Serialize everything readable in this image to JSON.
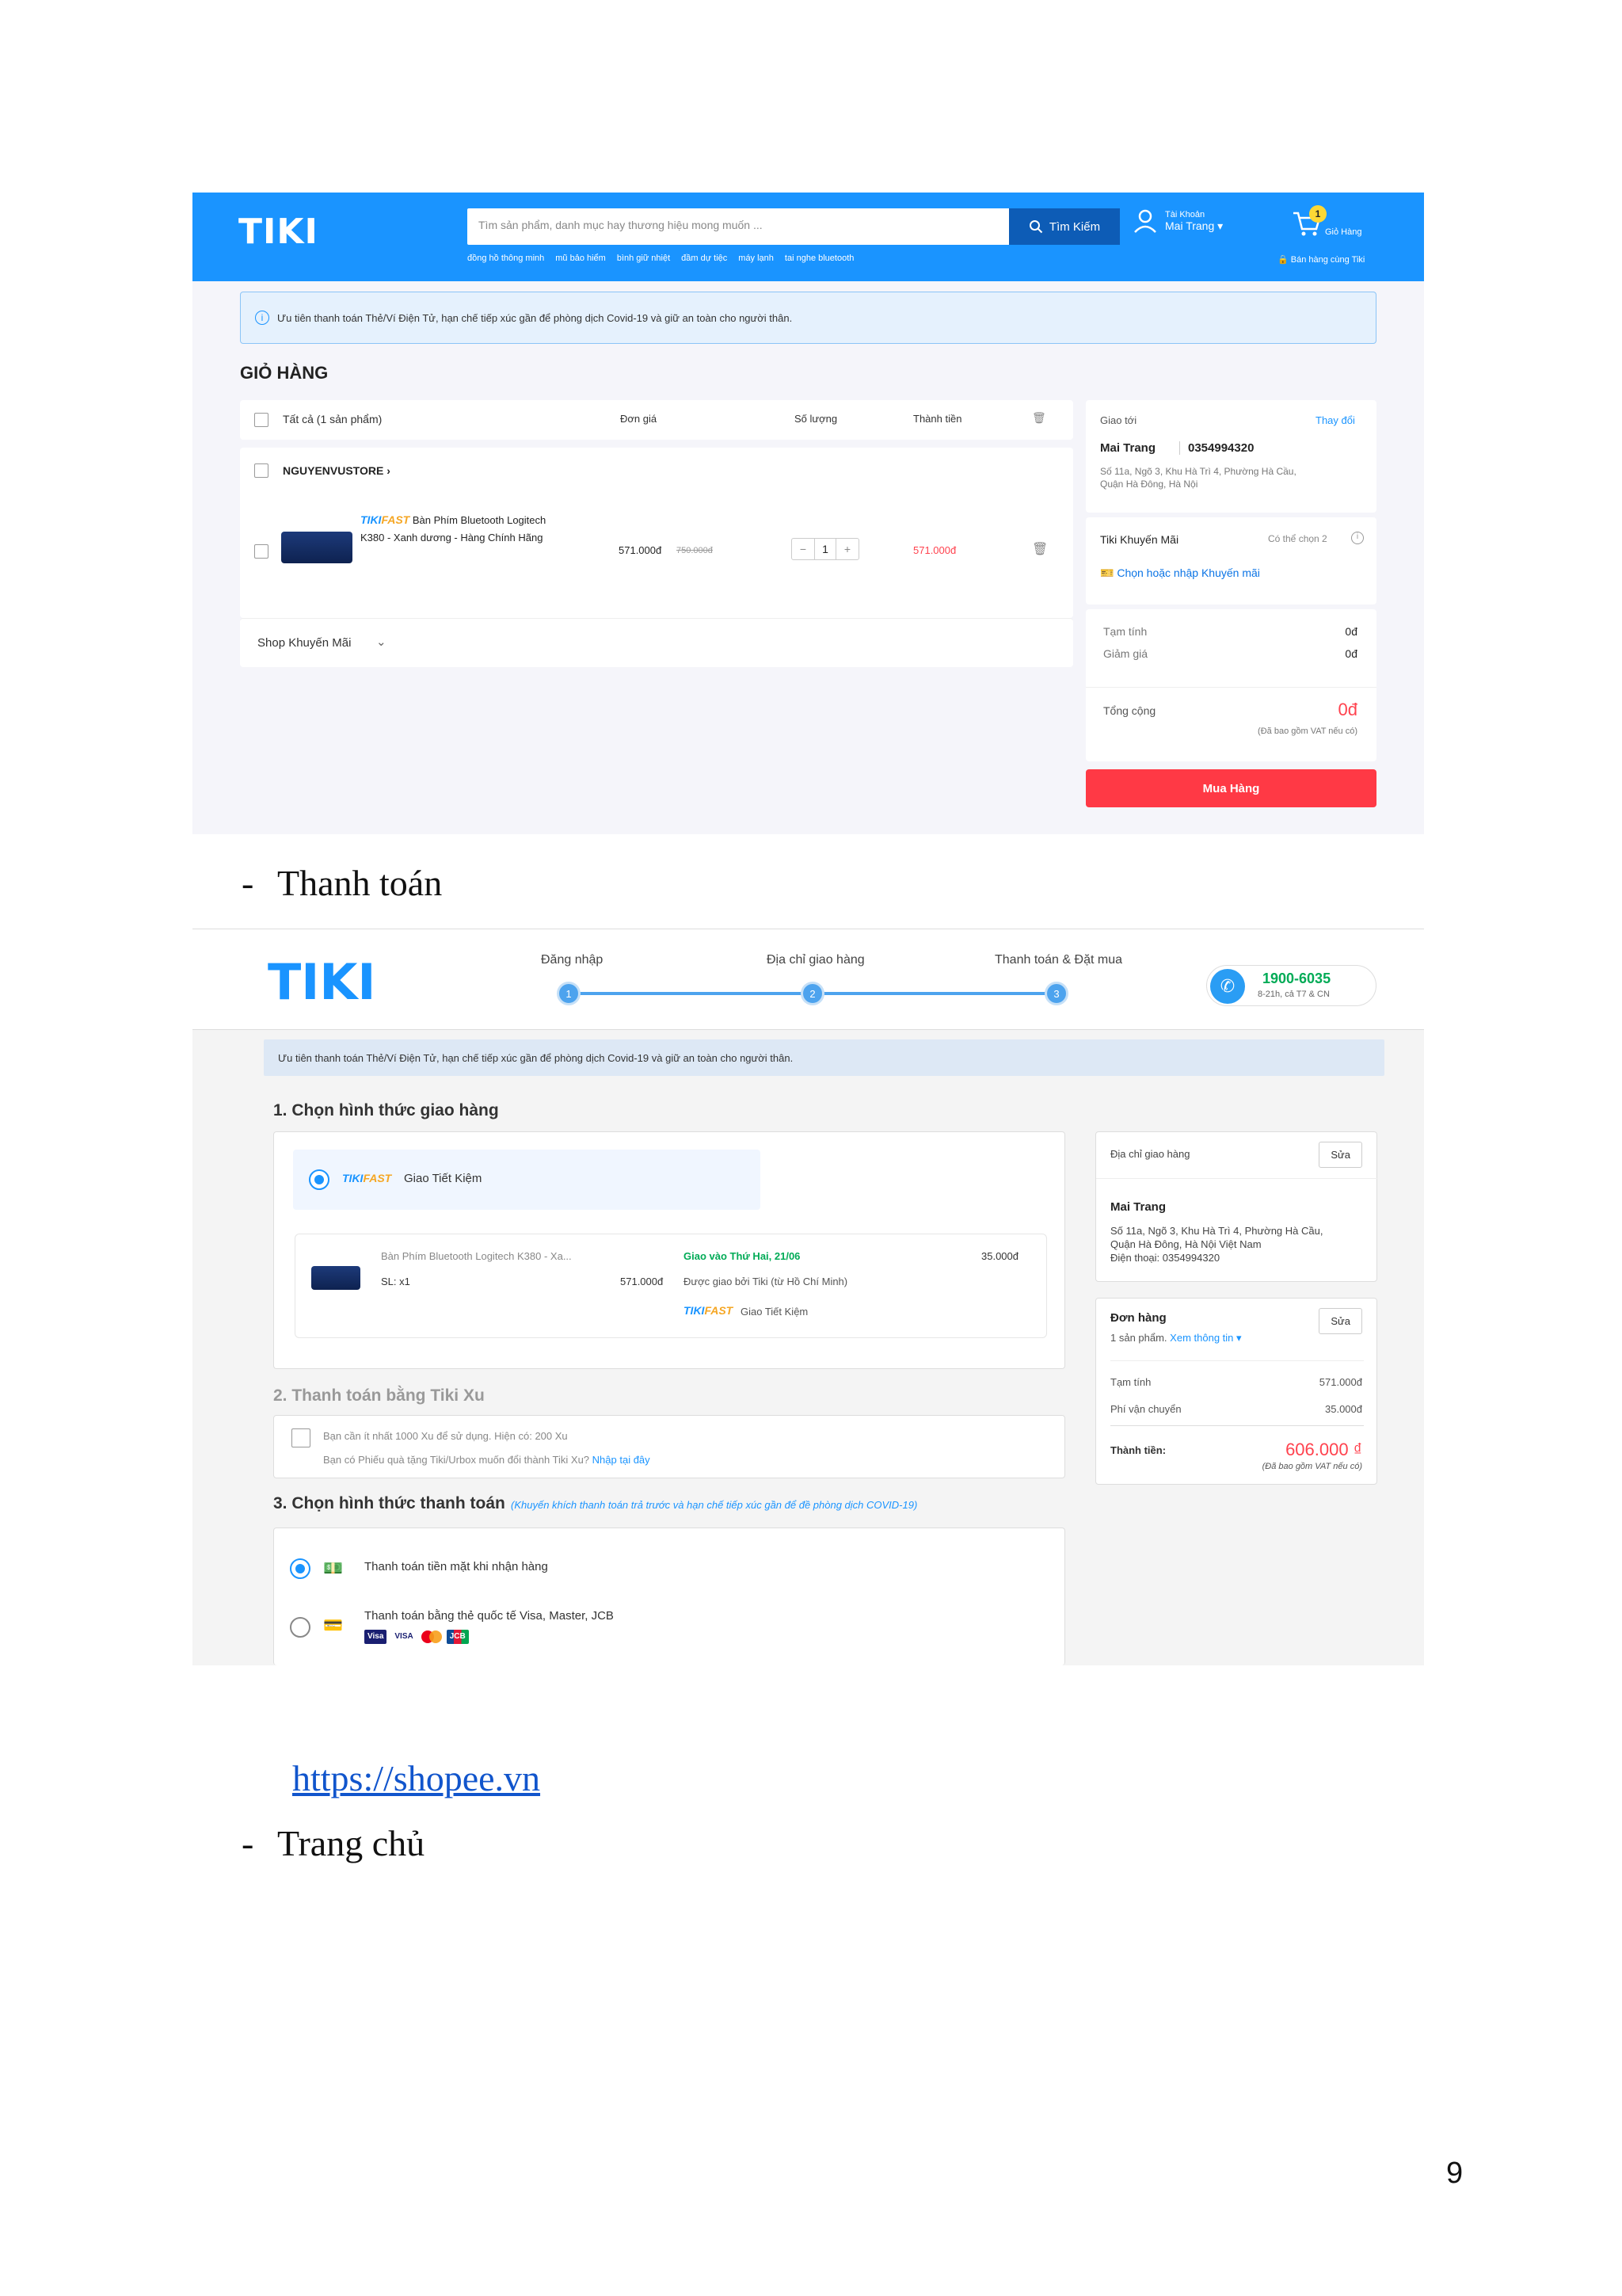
{
  "shot1": {
    "header": {
      "logo": "TIKI",
      "search_placeholder": "Tìm sản phẩm, danh mục hay thương hiệu mong muốn ...",
      "search_button": "Tìm Kiếm",
      "suggestions": [
        "đồng hồ thông minh",
        "mũ bảo hiểm",
        "bình giữ nhiệt",
        "đầm dự tiệc",
        "máy lạnh",
        "tai nghe bluetooth"
      ],
      "account_label": "Tài Khoản",
      "account_name": "Mai Trang",
      "cart_count": "1",
      "cart_label": "Giỏ Hàng",
      "sell_label": "Bán hàng cùng Tiki"
    },
    "notice": "Ưu tiên thanh toán Thẻ/Ví Điện Tử, hạn chế tiếp xúc gần để phòng dịch Covid-19 và giữ an toàn cho người thân.",
    "cart_title": "GIỎ HÀNG",
    "table_headers": {
      "all": "Tất cả (1 sản phẩm)",
      "unit_price": "Đơn giá",
      "quantity": "Số lượng",
      "total": "Thành tiền"
    },
    "store_name": "NGUYENVUSTORE",
    "item": {
      "fast_a": "TIKI",
      "fast_b": "FAST",
      "name_line1": "Bàn Phím Bluetooth Logitech",
      "name_line2": "K380 - Xanh dương - Hàng Chính Hãng",
      "price": "571.000đ",
      "old_price": "750.000đ",
      "qty": "1",
      "total": "571.000đ"
    },
    "shop_promo": "Shop Khuyến Mãi",
    "ship": {
      "label": "Giao tới",
      "change": "Thay đổi",
      "name": "Mai Trang",
      "phone": "0354994320",
      "addr1": "Số 11a, Ngõ 3, Khu Hà Trì 4, Phường Hà Cầu,",
      "addr2": "Quận Hà Đông, Hà Nội"
    },
    "promo": {
      "label": "Tiki Khuyến Mãi",
      "hint": "Có thể chọn 2",
      "link": "Chọn hoặc nhập Khuyến mãi"
    },
    "summary": {
      "subtotal_label": "Tạm tính",
      "subtotal": "0đ",
      "discount_label": "Giảm giá",
      "discount": "0đ",
      "total_label": "Tổng cộng",
      "total": "0đ",
      "vat": "(Đã bao gồm VAT nếu có)"
    },
    "buy_button": "Mua Hàng"
  },
  "caption1_dash": "-",
  "caption1": "Thanh toán",
  "shot2": {
    "logo": "TIKI",
    "steps": [
      {
        "label": "Đăng nhập",
        "num": "1"
      },
      {
        "label": "Địa chỉ giao hàng",
        "num": "2"
      },
      {
        "label": "Thanh toán & Đặt mua",
        "num": "3"
      }
    ],
    "hotline": "1900-6035",
    "hotline_hours": "8-21h, cả T7 & CN",
    "notice": "Ưu tiên thanh toán Thẻ/Ví Điện Tử, hạn chế tiếp xúc gần để phòng dịch Covid-19 và giữ an toàn cho người thân.",
    "sec1": "1. Chọn hình thức giao hàng",
    "delivery_option": "Giao Tiết Kiệm",
    "package": {
      "name": "Bàn Phím Bluetooth Logitech K380 - Xa...",
      "qty": "SL: x1",
      "price": "571.000đ",
      "date": "Giao vào Thứ Hai, 21/06",
      "by": "Được giao bởi Tiki (từ Hồ Chí Minh)",
      "fee": "35.000đ",
      "method": "Giao Tiết Kiệm"
    },
    "sec2": "2. Thanh toán bằng Tiki Xu",
    "xu_line1": "Bạn cần ít nhất 1000 Xu để sử dụng. Hiện có: 200 Xu",
    "xu_line2": "Bạn có Phiếu quà tặng Tiki/Urbox muốn đổi thành Tiki Xu?",
    "xu_link": "Nhập tại đây",
    "sec3": "3. Chọn hình thức thanh toán",
    "sec3_note": "(Khuyến khích thanh toán trả trước và hạn chế tiếp xúc gần để đề phòng dịch COVID-19)",
    "pay_cod": "Thanh toán tiền mặt khi nhận hàng",
    "pay_card": "Thanh toán bằng thẻ quốc tế Visa, Master, JCB",
    "card_logos": [
      "Visa",
      "VISA",
      "JCB"
    ],
    "address_box": {
      "title": "Địa chỉ giao hàng",
      "edit": "Sửa",
      "name": "Mai Trang",
      "line1": "Số 11a, Ngõ 3, Khu Hà Trì 4, Phường Hà Cầu,",
      "line2": "Quận Hà Đông, Hà Nội Việt Nam",
      "phone": "Điện thoại: 0354994320"
    },
    "order_box": {
      "title": "Đơn hàng",
      "edit": "Sửa",
      "count": "1 sản phẩm.",
      "details": "Xem thông tin",
      "subtotal_label": "Tạm tính",
      "subtotal": "571.000đ",
      "ship_label": "Phí vận chuyển",
      "ship": "35.000đ",
      "total_label": "Thành tiền:",
      "total": "606.000 ₫",
      "vat": "(Đã bao gồm VAT nếu có)"
    }
  },
  "link": "https://shopee.vn",
  "caption2_dash": "-",
  "caption2": "Trang chủ",
  "page_number": "9"
}
